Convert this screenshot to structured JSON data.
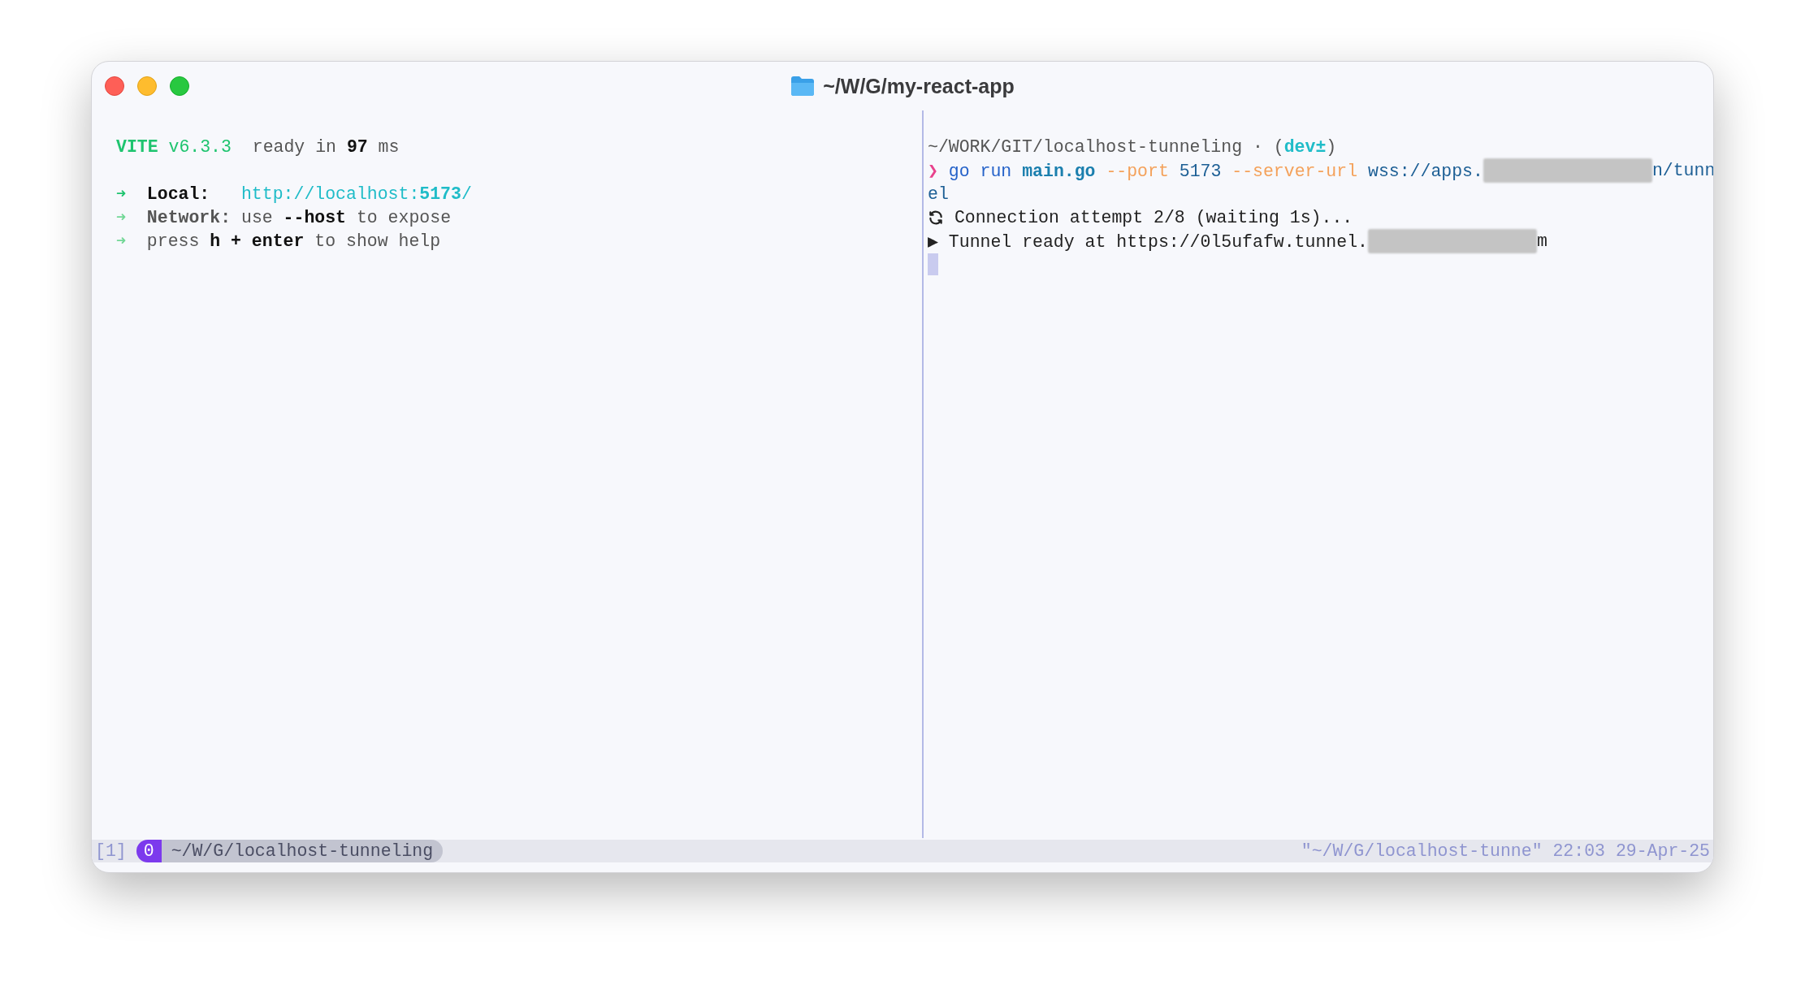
{
  "window": {
    "title": "~/W/G/my-react-app"
  },
  "panes": [
    {
      "lines": [
        {
          "kind": "text",
          "segments": [
            {
              "kind": "brand",
              "text": "VITE"
            },
            {
              "kind": "version",
              "text": " v6.3.3"
            },
            {
              "kind": "dim",
              "text": "  ready in "
            },
            {
              "kind": "strong",
              "text": "97"
            },
            {
              "kind": "dim",
              "text": " ms"
            }
          ]
        },
        {
          "kind": "blank"
        },
        {
          "kind": "text",
          "segments": [
            {
              "kind": "bullet",
              "text": "➜"
            },
            {
              "kind": "strong",
              "text": "  Local:"
            },
            {
              "kind": "link",
              "text": "   http://localhost:"
            },
            {
              "kind": "port",
              "text": "5173"
            },
            {
              "kind": "link",
              "text": "/"
            }
          ]
        },
        {
          "kind": "text",
          "segments": [
            {
              "kind": "marker",
              "text": "➜"
            },
            {
              "kind": "label",
              "text": "  Network:"
            },
            {
              "kind": "dim",
              "text": " use "
            },
            {
              "kind": "strong",
              "text": "--host"
            },
            {
              "kind": "dim",
              "text": " to expose"
            }
          ]
        },
        {
          "kind": "text",
          "segments": [
            {
              "kind": "marker",
              "text": "➜"
            },
            {
              "kind": "dim",
              "text": "  press "
            },
            {
              "kind": "strong",
              "text": "h + enter"
            },
            {
              "kind": "dim",
              "text": " to show help"
            }
          ]
        }
      ]
    },
    {
      "lines": [
        {
          "kind": "text",
          "segments": [
            {
              "kind": "dim",
              "text": "~/WORK/GIT/localhost-tunneling · ("
            },
            {
              "kind": "branch",
              "text": "dev±"
            },
            {
              "kind": "dim",
              "text": ")"
            }
          ]
        },
        {
          "kind": "text",
          "segments": [
            {
              "kind": "prompt",
              "text": "❯"
            },
            {
              "kind": "command",
              "text": " go run "
            },
            {
              "kind": "file",
              "text": "main.go"
            },
            {
              "kind": "flag",
              "text": " --port"
            },
            {
              "kind": "value",
              "text": " 5173"
            },
            {
              "kind": "flag",
              "text": " --server-url"
            },
            {
              "kind": "value",
              "text": " wss://apps."
            },
            {
              "kind": "redacted"
            },
            {
              "kind": "value",
              "text": "n/tunn"
            }
          ]
        },
        {
          "kind": "text",
          "segments": [
            {
              "kind": "value",
              "text": "el"
            }
          ]
        },
        {
          "kind": "text",
          "segments": [
            {
              "kind": "icon"
            },
            {
              "kind": "plain",
              "text": " Connection attempt 2/8 (waiting 1s)..."
            }
          ]
        },
        {
          "kind": "text",
          "segments": [
            {
              "kind": "plain",
              "text": "▶ Tunnel ready at https://0l5ufafw.tunnel."
            },
            {
              "kind": "redacted"
            },
            {
              "kind": "plain",
              "text": "m"
            }
          ]
        },
        {
          "kind": "cursor"
        }
      ]
    }
  ],
  "status_bar": {
    "window_index": "[1]",
    "pane_number": "0",
    "path": "~/W/G/localhost-tunneling",
    "right": "\"~/W/G/localhost-tunne\" 22:03 29-Apr-25"
  }
}
